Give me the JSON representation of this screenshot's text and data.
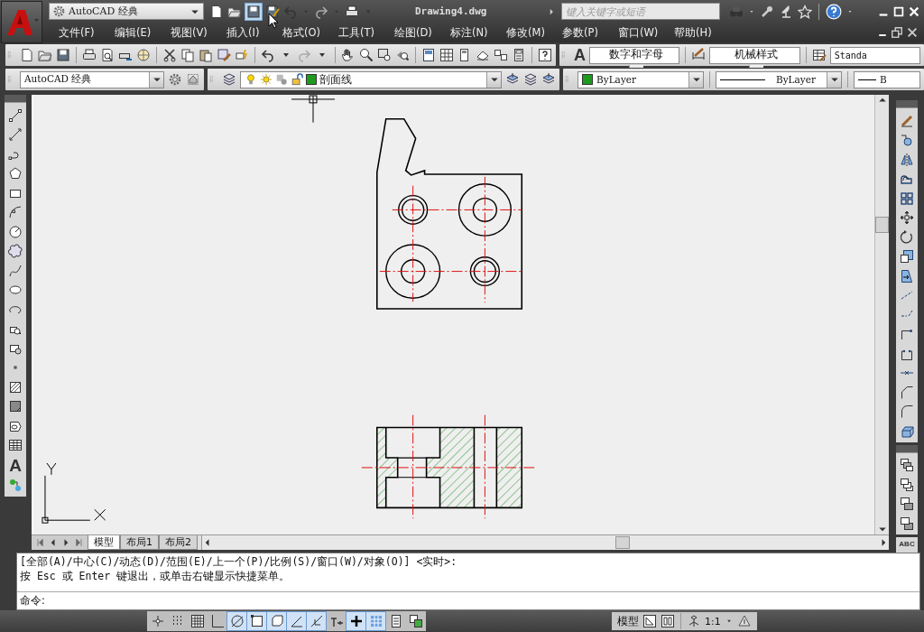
{
  "title_bar": {
    "workspace": "AutoCAD 经典",
    "title": "Drawing4.dwg",
    "search": {
      "placeholder": "键入关键字或短语"
    }
  },
  "menu_bar": [
    "文件(F)",
    "编辑(E)",
    "视图(V)",
    "插入(I)",
    "格式(O)",
    "工具(T)",
    "绘图(D)",
    "标注(N)",
    "修改(M)",
    "参数(P)",
    "窗口(W)",
    "帮助(H)"
  ],
  "styles_toolbar": {
    "text_style_glyph": "A",
    "text_style": "数字和字母",
    "dim_style": "机械样式",
    "table_style": "Standa"
  },
  "properties_bar": {
    "workspace": "AutoCAD 经典",
    "layer": {
      "name": "剖面线",
      "color": "#1f9a1f"
    },
    "color": {
      "label": "ByLayer",
      "color": "#1f9a1f"
    },
    "linetype": "ByLayer",
    "lineweight": "B"
  },
  "draw_toolbar": {
    "text_glyph": "A"
  },
  "modify_toolbar": {
    "spell_glyph": "ABC"
  },
  "layout_tabs": [
    {
      "label": "模型",
      "selected": true
    },
    {
      "label": "布局1",
      "selected": false
    },
    {
      "label": "布局2",
      "selected": false
    }
  ],
  "command_history": [
    "[全部(A)/中心(C)/动态(D)/范围(E)/上一个(P)/比例(S)/窗口(W)/对象(O)] <实时>:",
    "按 Esc 或 Enter 键退出，或单击右键显示快捷菜单。"
  ],
  "command_prompt": "命令:",
  "status_bar": {
    "toggles": [
      {
        "on": false
      },
      {
        "on": false
      },
      {
        "on": false
      },
      {
        "on": false
      },
      {
        "on": true
      },
      {
        "on": true
      },
      {
        "on": true
      },
      {
        "on": true
      },
      {
        "on": true
      },
      {
        "on": false
      },
      {
        "on": true
      },
      {
        "on": true
      },
      {
        "on": false
      },
      {
        "on": false
      }
    ],
    "space": "模型",
    "scale": "1:1"
  }
}
